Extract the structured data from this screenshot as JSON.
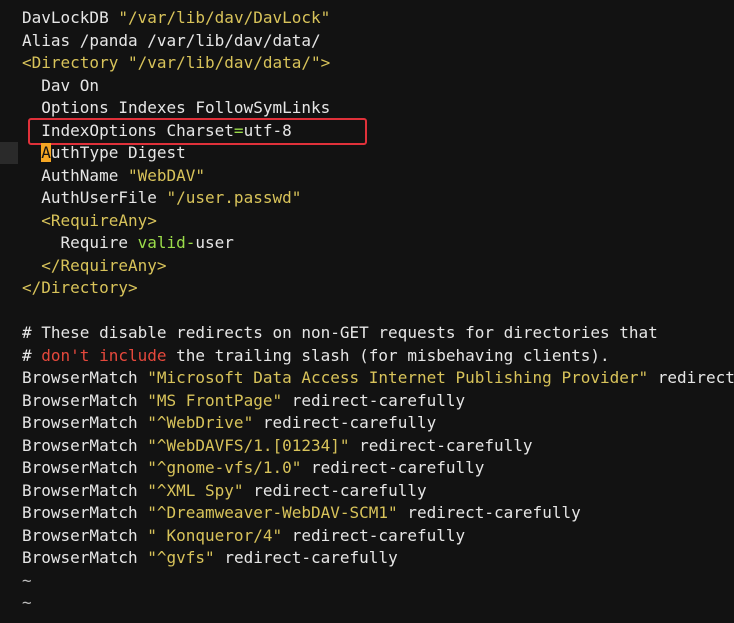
{
  "editor": {
    "lines": {
      "l1": {
        "kw": "DavLockDB",
        "str": "\"/var/lib/dav/DavLock\""
      },
      "l2": {
        "text": "Alias /panda /var/lib/dav/data/"
      },
      "l3": {
        "open": "<Directory",
        "str": "\"/var/lib/dav/data/\"",
        "close": ">"
      },
      "l4": {
        "text": "  Dav On"
      },
      "l5": {
        "text": "  Options Indexes FollowSymLinks"
      },
      "l6": {
        "text": "  IndexOptions Charset",
        "eq": "=",
        "rest": "utf-8"
      },
      "l7": {
        "cursor": "A",
        "rest": "uthType Digest",
        "indent": "  "
      },
      "l8": {
        "kw": "  AuthName",
        "str": "\"WebDAV\""
      },
      "l9": {
        "kw": "  AuthUserFile",
        "str": "\"/user.passwd\""
      },
      "l10": {
        "text": "  <RequireAny>"
      },
      "l11": {
        "pre": "    Require ",
        "green": "valid",
        "dash": "-",
        "post": "user"
      },
      "l12": {
        "text": "  </RequireAny>"
      },
      "l13": {
        "text": "</Directory>"
      },
      "l14": {
        "text": ""
      },
      "l15": {
        "text": "# These disable redirects on non-GET requests for directories that"
      },
      "l16": {
        "pre": "# ",
        "red": "don't include",
        "post": " the trailing slash (for misbehaving clients)."
      },
      "l17": {
        "kw": "BrowserMatch",
        "str": "\"Microsoft Data Access Internet Publishing Provider\"",
        "rest": "redirect-carefully"
      },
      "l18": {
        "kw": "BrowserMatch",
        "str": "\"MS FrontPage\"",
        "rest": "redirect-carefully"
      },
      "l19": {
        "kw": "BrowserMatch",
        "str": "\"^WebDrive\"",
        "rest": "redirect-carefully"
      },
      "l20": {
        "kw": "BrowserMatch",
        "str": "\"^WebDAVFS/1.[01234]\"",
        "rest": "redirect-carefully"
      },
      "l21": {
        "kw": "BrowserMatch",
        "str": "\"^gnome-vfs/1.0\"",
        "rest": "redirect-carefully"
      },
      "l22": {
        "kw": "BrowserMatch",
        "str": "\"^XML Spy\"",
        "rest": "redirect-carefully"
      },
      "l23": {
        "kw": "BrowserMatch",
        "str": "\"^Dreamweaver-WebDAV-SCM1\"",
        "rest": "redirect-carefully"
      },
      "l24": {
        "kw": "BrowserMatch",
        "str": "\" Konqueror/4\"",
        "rest": "redirect-carefully"
      },
      "l25": {
        "kw": "BrowserMatch",
        "str": "\"^gvfs\"",
        "rest": "redirect-carefully"
      },
      "l26": {
        "text": "~"
      },
      "l27": {
        "text": "~"
      }
    },
    "colors": {
      "background": "#121212",
      "text": "#e6e6e6",
      "string": "#d8c35a",
      "keyword_green": "#9bdc4a",
      "keyword_red": "#e5483c",
      "highlight_box": "#e0313a",
      "cursor": "#f5a623"
    }
  }
}
